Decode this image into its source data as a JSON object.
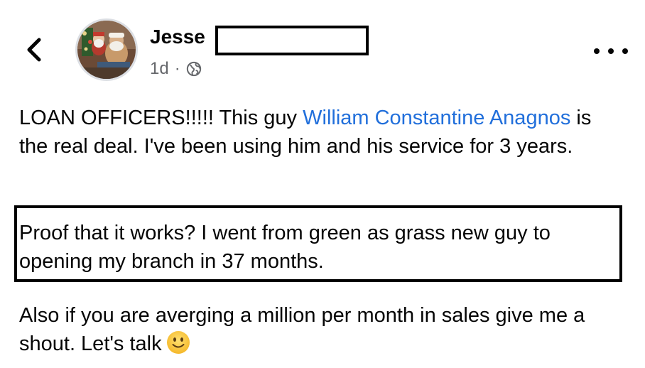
{
  "header": {
    "back_icon": "chevron-left-icon",
    "author_name": "Jesse",
    "timestamp": "1d",
    "separator": "·",
    "privacy_icon": "globe-icon",
    "more_icon": "more-horizontal-icon"
  },
  "post": {
    "para1_before": "LOAN OFFICERS!!!!! This guy ",
    "mention": "William Constantine Anagnos",
    "para1_after": " is the real deal. I've been using him and his service for 3 years.",
    "para2": "Proof that it works? I went from green as grass new guy to opening my branch in 37 months.",
    "para3": "Also if you are averging a million per month in sales give me a shout. Let's talk",
    "emoji_icon": "slightly-smiling-face-emoji"
  },
  "colors": {
    "mention": "#216fdb",
    "meta_text": "#65676b",
    "text": "#050505"
  }
}
